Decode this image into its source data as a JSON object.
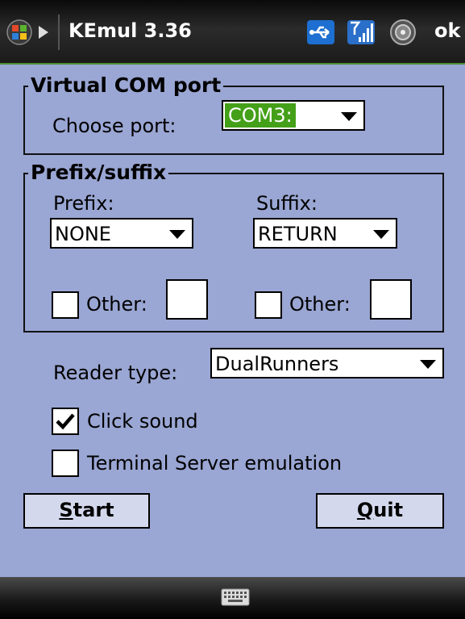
{
  "titlebar": {
    "app_title": "KEmul 3.36",
    "ok_label": "ok",
    "icons": [
      "windows-start-icon",
      "usb-icon",
      "signal-icon",
      "sound-icon"
    ]
  },
  "com_group": {
    "legend": "Virtual COM port",
    "choose_port_label": "Choose port:",
    "port_value": "COM3:"
  },
  "prefix_group": {
    "legend": "Prefix/suffix",
    "prefix_label": "Prefix:",
    "prefix_value": "NONE",
    "suffix_label": "Suffix:",
    "suffix_value": "RETURN",
    "prefix_other_label": "Other:",
    "suffix_other_label": "Other:",
    "prefix_other_checked": false,
    "suffix_other_checked": false
  },
  "reader": {
    "label": "Reader type:",
    "value": "DualRunners"
  },
  "options": {
    "click_sound_label": "Click sound",
    "click_sound_checked": true,
    "terminal_label": "Terminal Server emulation",
    "terminal_checked": false
  },
  "buttons": {
    "start_first": "S",
    "start_rest": "tart",
    "quit_first": "Q",
    "quit_rest": "uit"
  },
  "colors": {
    "background": "#9aa6d3",
    "highlight": "#44a018",
    "titlebar": "#1a1a1a"
  }
}
